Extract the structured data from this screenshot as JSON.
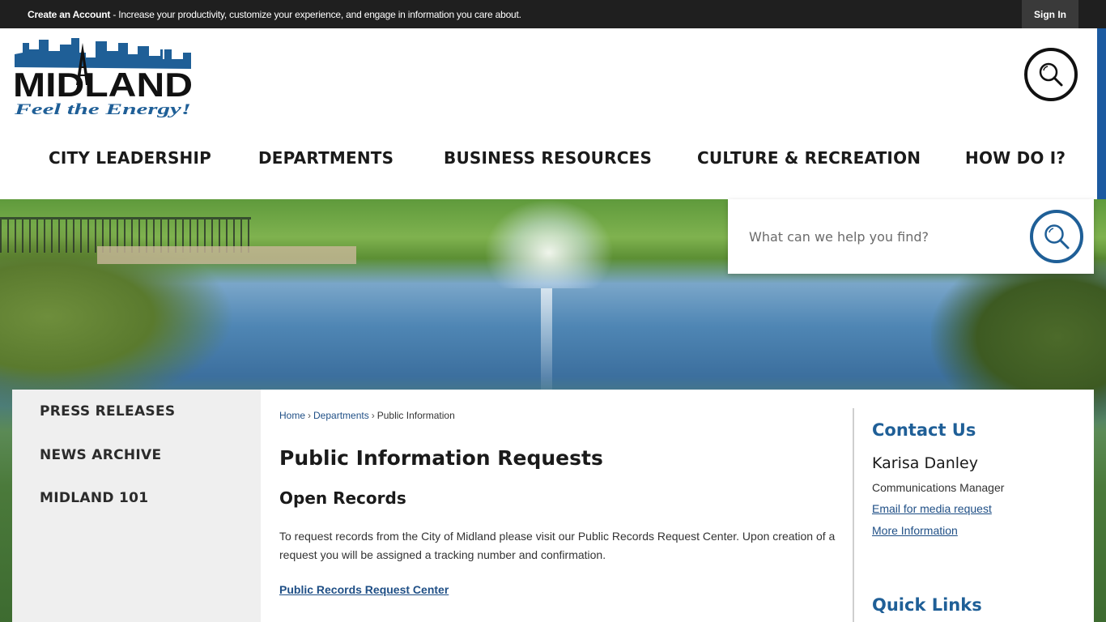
{
  "topbar": {
    "create_account": "Create an Account",
    "message": " - Increase your productivity, customize your experience, and engage in information you care about.",
    "sign_in": "Sign In"
  },
  "logo": {
    "name": "MIDLAND",
    "tagline": "Feel the Energy!"
  },
  "nav": {
    "items": [
      {
        "label": "CITY LEADERSHIP"
      },
      {
        "label": "DEPARTMENTS"
      },
      {
        "label": "BUSINESS RESOURCES"
      },
      {
        "label": "CULTURE & RECREATION"
      },
      {
        "label": "HOW DO I?"
      }
    ]
  },
  "search": {
    "placeholder": "What can we help you find?"
  },
  "sidebar": {
    "items": [
      {
        "label": "PRESS RELEASES"
      },
      {
        "label": "NEWS ARCHIVE"
      },
      {
        "label": "MIDLAND 101"
      }
    ]
  },
  "breadcrumb": {
    "home": "Home",
    "separator": "›",
    "departments": "Departments",
    "current": "Public Information"
  },
  "main": {
    "title": "Public Information Requests",
    "subtitle": "Open Records",
    "body": "To request records from the City of Midland please visit our Public Records Request Center. Upon creation of a request you will be assigned a tracking number and confirmation.",
    "records_link": "Public Records Request Center"
  },
  "aside": {
    "contact_heading": "Contact Us",
    "contact_name": "Karisa Danley",
    "contact_role": "Communications Manager",
    "email_link": "Email for media request",
    "more_link": "More Information",
    "quick_links_heading": "Quick Links"
  },
  "colors": {
    "topbar": "#1f1f1f",
    "accent_blue": "#1f5f97",
    "link_blue": "#1f4f86",
    "sidebar_bg": "#efefef"
  }
}
